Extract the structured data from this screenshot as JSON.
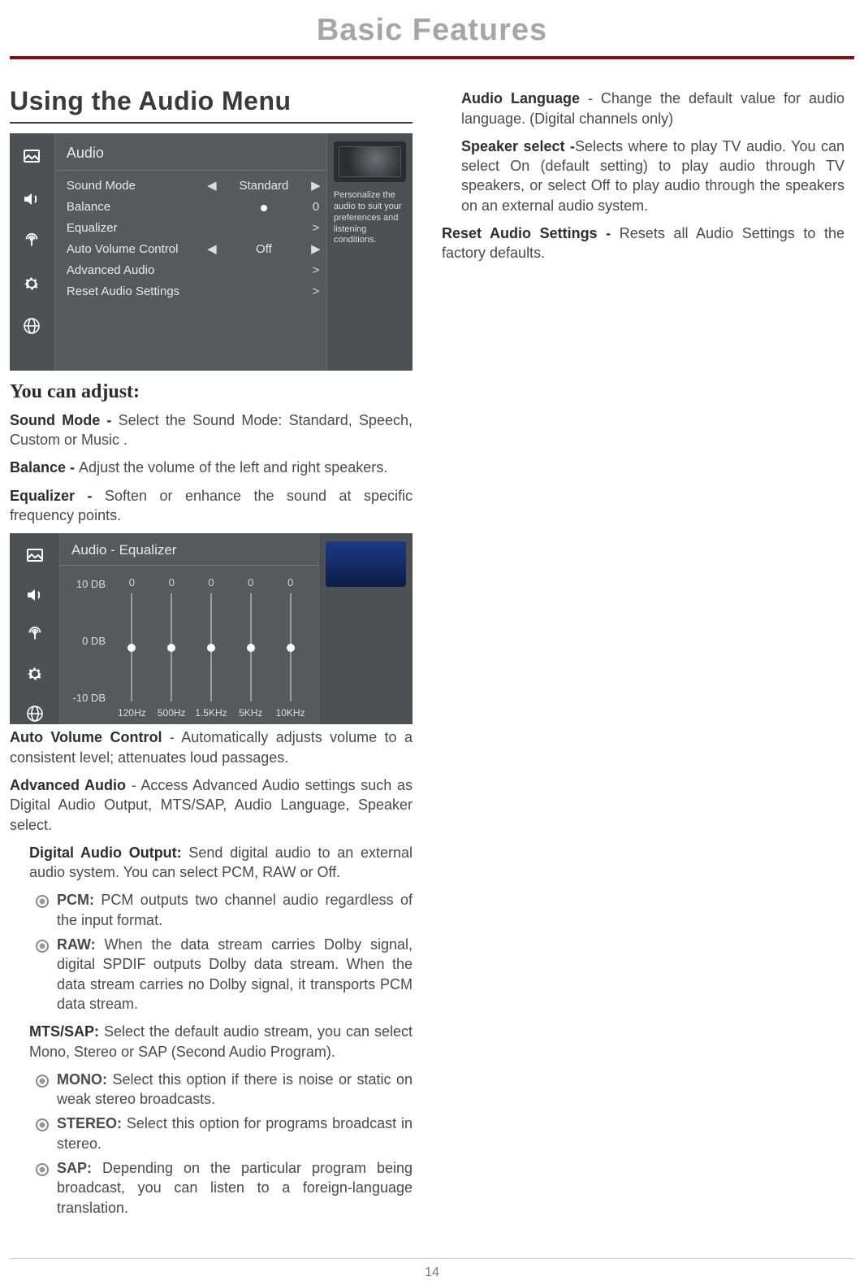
{
  "header": {
    "title": "Basic Features"
  },
  "section_title": "Using the Audio Menu",
  "osd1": {
    "title": "Audio",
    "rows": {
      "sound_mode": {
        "label": "Sound Mode",
        "value": "Standard"
      },
      "balance": {
        "label": "Balance",
        "value": "0"
      },
      "equalizer": {
        "label": "Equalizer",
        "more": ">"
      },
      "auto_volume": {
        "label": "Auto Volume Control",
        "value": "Off"
      },
      "advanced": {
        "label": "Advanced Audio",
        "more": ">"
      },
      "reset": {
        "label": "Reset Audio Settings",
        "more": ">"
      }
    },
    "help": "Personalize the audio to suit your preferences and listening conditions."
  },
  "subheading": "You can adjust:",
  "para": {
    "sound_mode_b": "Sound Mode - ",
    "sound_mode_t": "Select the Sound Mode: Standard, Speech, Custom or Music .",
    "balance_b": "Balance - ",
    "balance_t": "Adjust the volume of the left and right speakers.",
    "equalizer_b": "Equalizer - ",
    "equalizer_t": "Soften or enhance the sound at specific frequency points.",
    "avc_b": "Auto Volume Control",
    "avc_t": " - Automatically adjusts volume to a consistent level; attenuates loud passages.",
    "adv_b": "Advanced Audio",
    "adv_t": " - Access Advanced Audio settings such as Digital Audio Output, MTS/SAP, Audio Language, Speaker select.",
    "dao_b": "Digital Audio Output: ",
    "dao_t": "Send digital audio to an external audio system. You can select PCM, RAW or Off.",
    "pcm_b": "PCM: ",
    "pcm_t": "PCM outputs two channel audio regardless of the input format.",
    "raw_b": "RAW: ",
    "raw_t": "When the data stream carries Dolby signal, digital SPDIF outputs Dolby data stream. When the data stream carries no Dolby signal, it transports PCM data stream.",
    "mts_b": "MTS/SAP: ",
    "mts_t": "Select the default audio stream, you can select Mono, Stereo or SAP (Second Audio Program).",
    "mono_b": "MONO: ",
    "mono_t": "Select this option if there is noise or static on weak stereo broadcasts.",
    "stereo_b": "STEREO: ",
    "stereo_t": "Select this option for programs broadcast in stereo.",
    "sap_b": "SAP: ",
    "sap_t": "Depending on the particular program being broadcast, you can listen to a foreign-language translation.",
    "lang_b": "Audio Language",
    "lang_t": " - Change the default value for audio language. (Digital channels only)",
    "spk_b": "Speaker select -",
    "spk_t": "Selects where to play TV audio. You can select On (default setting) to play audio through TV speakers, or select Off to play audio through the speakers on an external audio system.",
    "reset_b": "Reset Audio Settings - ",
    "reset_t": "Resets all Audio Settings to the factory defaults."
  },
  "chart_data": {
    "type": "bar",
    "title": "Audio - Equalizer",
    "ylabel": "dB",
    "ylim": [
      -10,
      10
    ],
    "yticks": [
      "10 DB",
      "0 DB",
      "-10 DB"
    ],
    "categories": [
      "120Hz",
      "500Hz",
      "1.5KHz",
      "5KHz",
      "10KHz"
    ],
    "values": [
      0,
      0,
      0,
      0,
      0
    ],
    "top_labels": [
      "0",
      "0",
      "0",
      "0",
      "0"
    ]
  },
  "page_number": "14"
}
